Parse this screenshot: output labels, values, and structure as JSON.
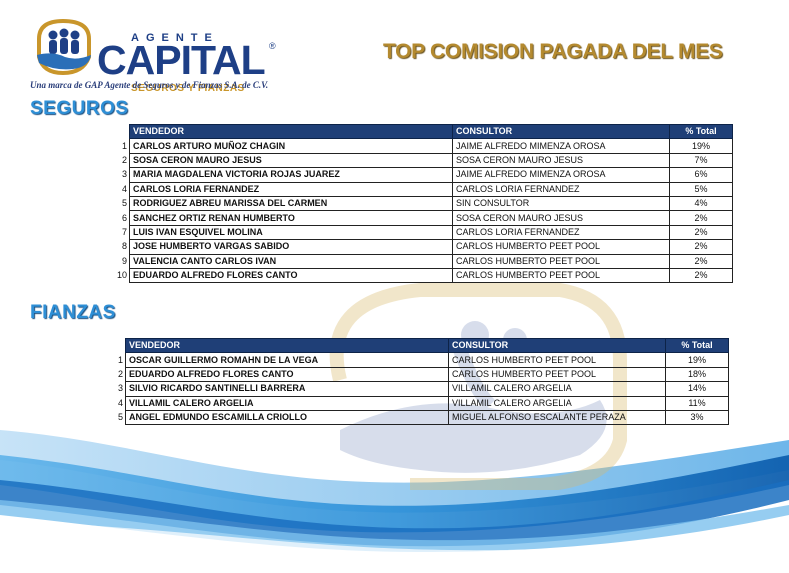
{
  "brand": {
    "agente": "AGENTE",
    "capital": "CAPITAL",
    "registered": "®",
    "sub": "SEGUROS Y FIANZAS",
    "tagline": "Una marca de GAP Agente de Seguros y de Fianzas S.A. de C.V."
  },
  "title": "TOP COMISION PAGADA DEL MES",
  "seguros": {
    "heading": "SEGUROS",
    "columns": {
      "vendedor": "VENDEDOR",
      "consultor": "CONSULTOR",
      "pct": "% Total"
    },
    "rows": [
      {
        "n": "1",
        "vendedor": "CARLOS ARTURO MUÑOZ CHAGIN",
        "consultor": "JAIME ALFREDO MIMENZA OROSA",
        "pct": "19%"
      },
      {
        "n": "2",
        "vendedor": "SOSA CERON MAURO JESUS",
        "consultor": "SOSA CERON MAURO JESUS",
        "pct": "7%"
      },
      {
        "n": "3",
        "vendedor": "MARIA MAGDALENA VICTORIA ROJAS JUAREZ",
        "consultor": "JAIME ALFREDO MIMENZA OROSA",
        "pct": "6%"
      },
      {
        "n": "4",
        "vendedor": "CARLOS LORIA FERNANDEZ",
        "consultor": "CARLOS LORIA FERNANDEZ",
        "pct": "5%"
      },
      {
        "n": "5",
        "vendedor": "RODRIGUEZ ABREU MARISSA DEL CARMEN",
        "consultor": "SIN CONSULTOR",
        "pct": "4%"
      },
      {
        "n": "6",
        "vendedor": "SANCHEZ ORTIZ RENAN HUMBERTO",
        "consultor": "SOSA CERON MAURO JESUS",
        "pct": "2%"
      },
      {
        "n": "7",
        "vendedor": "LUIS IVAN ESQUIVEL MOLINA",
        "consultor": "CARLOS LORIA FERNANDEZ",
        "pct": "2%"
      },
      {
        "n": "8",
        "vendedor": "JOSE HUMBERTO VARGAS SABIDO",
        "consultor": "CARLOS HUMBERTO PEET POOL",
        "pct": "2%"
      },
      {
        "n": "9",
        "vendedor": "VALENCIA CANTO CARLOS IVAN",
        "consultor": "CARLOS HUMBERTO PEET POOL",
        "pct": "2%"
      },
      {
        "n": "10",
        "vendedor": "EDUARDO ALFREDO FLORES CANTO",
        "consultor": "CARLOS HUMBERTO PEET POOL",
        "pct": "2%"
      }
    ]
  },
  "fianzas": {
    "heading": "FIANZAS",
    "columns": {
      "vendedor": "VENDEDOR",
      "consultor": "CONSULTOR",
      "pct": "% Total"
    },
    "rows": [
      {
        "n": "1",
        "vendedor": "OSCAR GUILLERMO ROMAHN DE LA VEGA",
        "consultor": "CARLOS HUMBERTO PEET POOL",
        "pct": "19%"
      },
      {
        "n": "2",
        "vendedor": "EDUARDO ALFREDO FLORES CANTO",
        "consultor": "CARLOS HUMBERTO PEET POOL",
        "pct": "18%"
      },
      {
        "n": "3",
        "vendedor": "SILVIO RICARDO SANTINELLI BARRERA",
        "consultor": "VILLAMIL CALERO ARGELIA",
        "pct": "14%"
      },
      {
        "n": "4",
        "vendedor": "VILLAMIL CALERO ARGELIA",
        "consultor": "VILLAMIL CALERO ARGELIA",
        "pct": "11%"
      },
      {
        "n": "5",
        "vendedor": "ANGEL EDMUNDO ESCAMILLA CRIOLLO",
        "consultor": "MIGUEL ALFONSO ESCALANTE PERAZA",
        "pct": "3%"
      }
    ]
  },
  "colors": {
    "header_bg": "#1f3f77",
    "section_title": "#2e8fd6",
    "main_title": "#b48a2f",
    "brand_blue": "#1e3f86",
    "brand_gold": "#c9962b",
    "wave_blue": "#2b8fd8"
  },
  "icons": {
    "logo": "family-hand-logo-icon",
    "watermark": "hand-watermark-icon"
  }
}
